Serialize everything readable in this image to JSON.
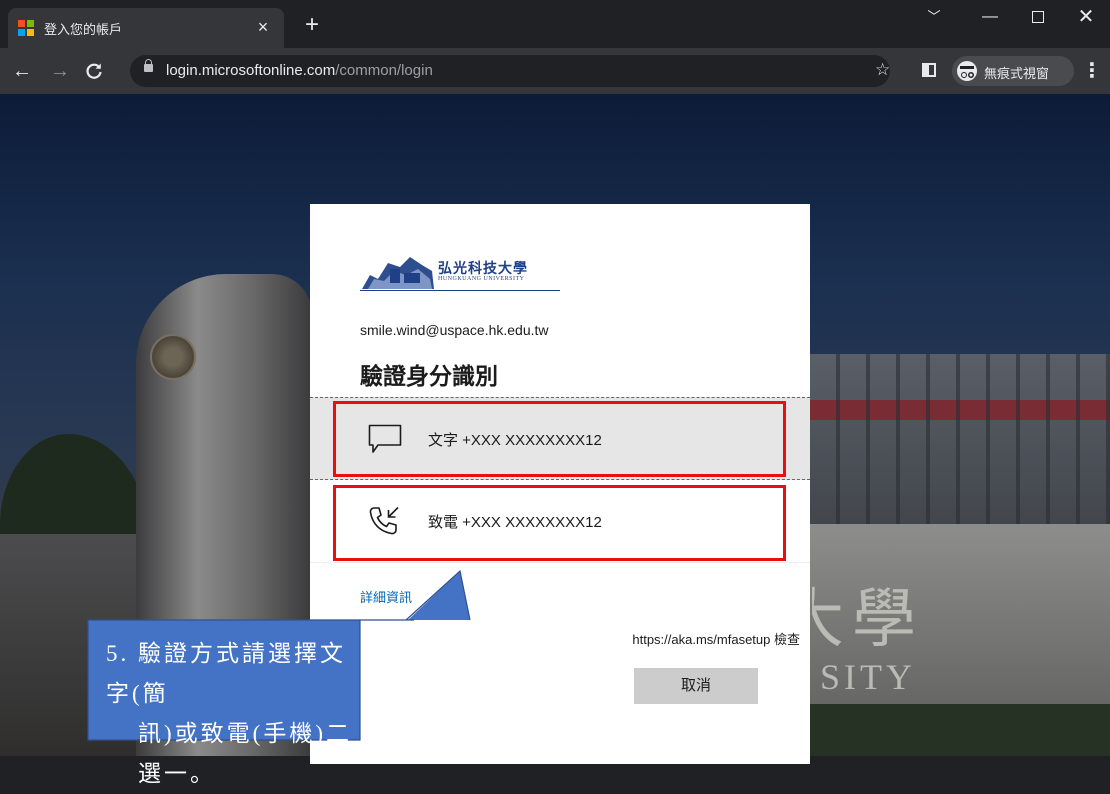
{
  "browser": {
    "tab_title": "登入您的帳戶",
    "url_host": "login.microsoftonline.com",
    "url_path": "/common/login",
    "incognito_label": "無痕式視窗",
    "icons": [
      "microsoft-logo-icon",
      "close-icon",
      "new-tab-icon",
      "back-icon",
      "forward-icon",
      "reload-icon",
      "lock-icon",
      "star-icon",
      "side-panel-icon",
      "incognito-icon",
      "more-menu-icon",
      "minimize-icon",
      "maximize-icon",
      "window-close-icon",
      "tab-search-icon"
    ]
  },
  "login": {
    "logo_cn": "弘光科技大學",
    "logo_en": "HUNGKUANG UNIVERSITY",
    "email": "smile.wind@uspace.hk.edu.tw",
    "heading": "驗證身分識別",
    "options": [
      {
        "label": "文字 +XXX XXXXXXXX12",
        "icon": "message-icon",
        "selected": true
      },
      {
        "label": "致電 +XXX XXXXXXXX12",
        "icon": "phone-call-icon",
        "selected": false
      }
    ],
    "more_info": "詳細資訊",
    "hint_suffix": "https://aka.ms/mfasetup 檢查",
    "cancel_label": "取消"
  },
  "background_text": {
    "xue": "學",
    "sity": "SITY",
    "da": "大"
  },
  "annotation": {
    "line1": "5. 驗證方式請選擇文字(簡",
    "line2": "訊)或致電(手機)二選一。",
    "colors": {
      "fill": "#4472c4",
      "stroke": "#2f528f",
      "highlight": "#e8100f"
    }
  }
}
